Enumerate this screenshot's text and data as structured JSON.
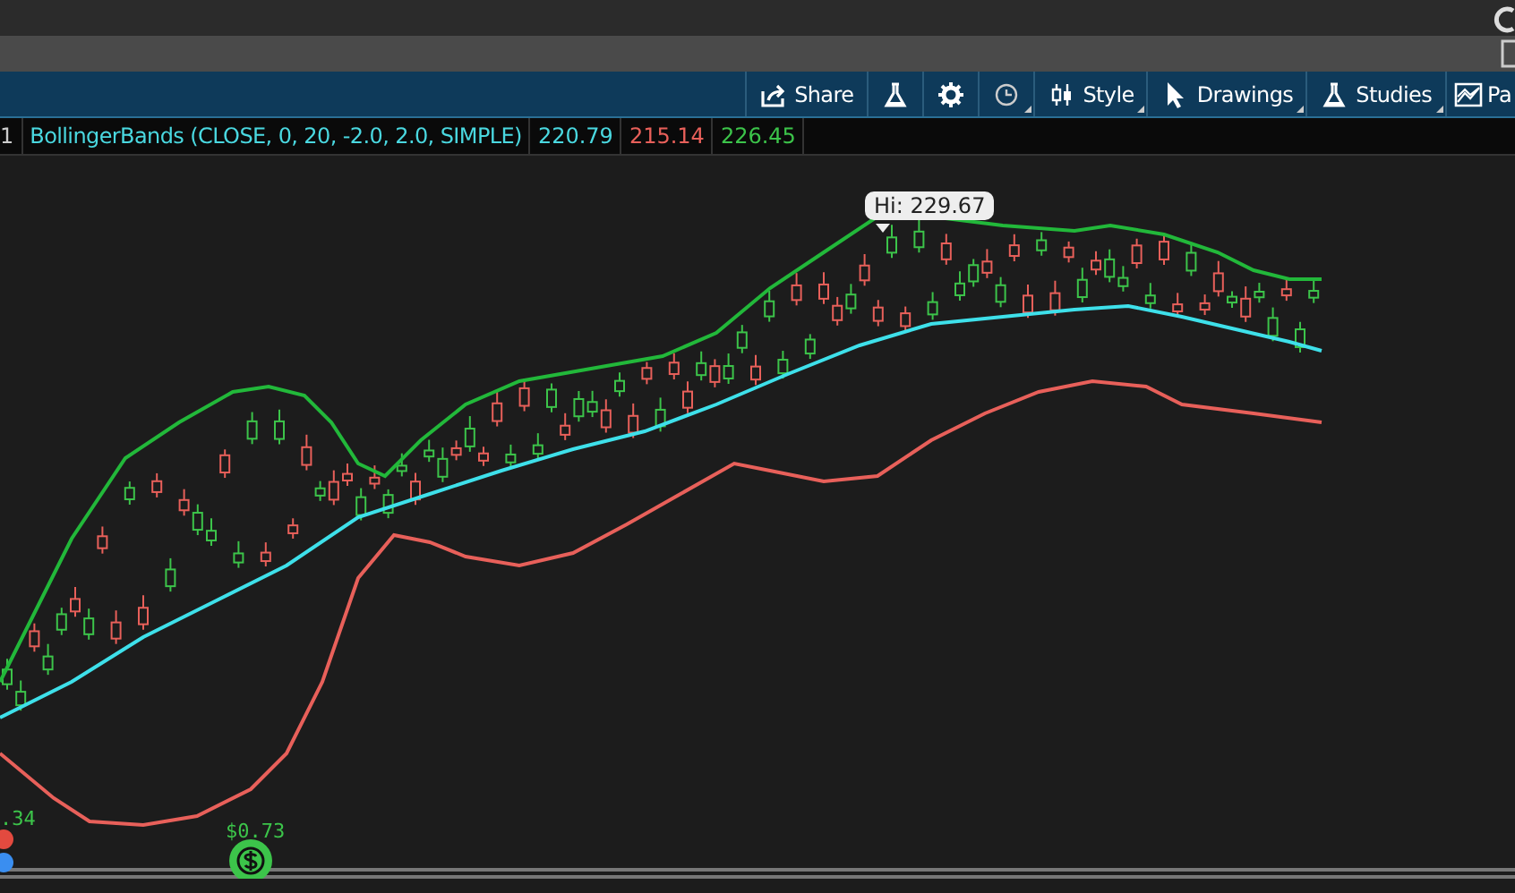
{
  "toolbar": [
    {
      "kind": "share",
      "label": "Share",
      "dropdown": false
    },
    {
      "kind": "flask",
      "dropdown": false
    },
    {
      "kind": "gear",
      "dropdown": false
    },
    {
      "kind": "clock",
      "dropdown": true
    },
    {
      "kind": "candles",
      "label": "Style",
      "dropdown": true
    },
    {
      "kind": "pointer",
      "label": "Drawings",
      "dropdown": true
    },
    {
      "kind": "flask",
      "label": "Studies",
      "dropdown": true
    },
    {
      "kind": "pattern",
      "label": "Pa",
      "dropdown": false
    }
  ],
  "study_legend": {
    "index": "1",
    "name": "BollingerBands (CLOSE, 0, 20, -2.0, 2.0, SIMPLE)",
    "values": [
      {
        "text": "220.79",
        "kind": "middle"
      },
      {
        "text": "215.14",
        "kind": "lower"
      },
      {
        "text": "226.45",
        "kind": "upper"
      }
    ]
  },
  "chart": {
    "tooltip": "Hi: 229.67",
    "dividends": [
      {
        "amount": ".34",
        "color": "#3cc44a"
      },
      {
        "amount": "$0.73",
        "color": "#3cc44a"
      }
    ]
  }
}
